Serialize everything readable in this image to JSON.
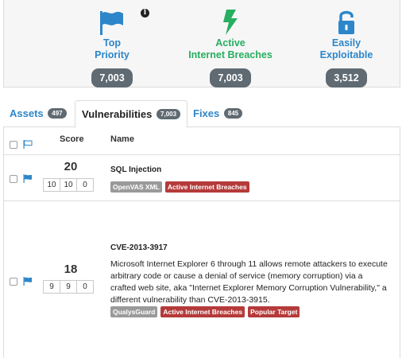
{
  "summary": {
    "stats": [
      {
        "label_line1": "Top",
        "label_line2": "Priority",
        "count": "7,003",
        "icon": "flag-icon",
        "color": "#2c86c9"
      },
      {
        "label_line1": "Active",
        "label_line2": "Internet Breaches",
        "count": "7,003",
        "icon": "lightning-icon",
        "color": "#27ae60"
      },
      {
        "label_line1": "Easily",
        "label_line2": "Exploitable",
        "count": "3,512",
        "icon": "unlock-icon",
        "color": "#2c86c9"
      }
    ],
    "info_icon": "info-icon",
    "info_glyph": "i"
  },
  "tabs": [
    {
      "label": "Assets",
      "count": "497"
    },
    {
      "label": "Vulnerabilities",
      "count": "7,003",
      "active": true
    },
    {
      "label": "Fixes",
      "count": "845"
    }
  ],
  "table": {
    "headers": {
      "score": "Score",
      "name": "Name"
    },
    "rows": [
      {
        "score": "20",
        "breakdown": [
          "10",
          "10",
          "0"
        ],
        "name": "SQL Injection",
        "tags": [
          {
            "label": "OpenVAS XML",
            "type": "grey"
          },
          {
            "label": "Active Internet Breaches",
            "type": "red"
          }
        ]
      },
      {
        "score": "18",
        "breakdown": [
          "9",
          "9",
          "0"
        ],
        "name": "CVE-2013-3917",
        "description": "Microsoft Internet Explorer 6 through 11 allows remote attackers to execute arbitrary code or cause a denial of service (memory corruption) via a crafted web site, aka \"Internet Explorer Memory Corruption Vulnerability,\" a different vulnerability than CVE-2013-3915.",
        "tags": [
          {
            "label": "QualysGuard",
            "type": "grey"
          },
          {
            "label": "Active Internet Breaches",
            "type": "red"
          },
          {
            "label": "Popular Target",
            "type": "red"
          }
        ]
      }
    ]
  },
  "colors": {
    "accent_blue": "#2c86c9",
    "accent_green": "#27ae60",
    "badge_grey": "#5f6a72",
    "tag_red": "#b53a3a",
    "tag_grey": "#9a9a9a"
  }
}
